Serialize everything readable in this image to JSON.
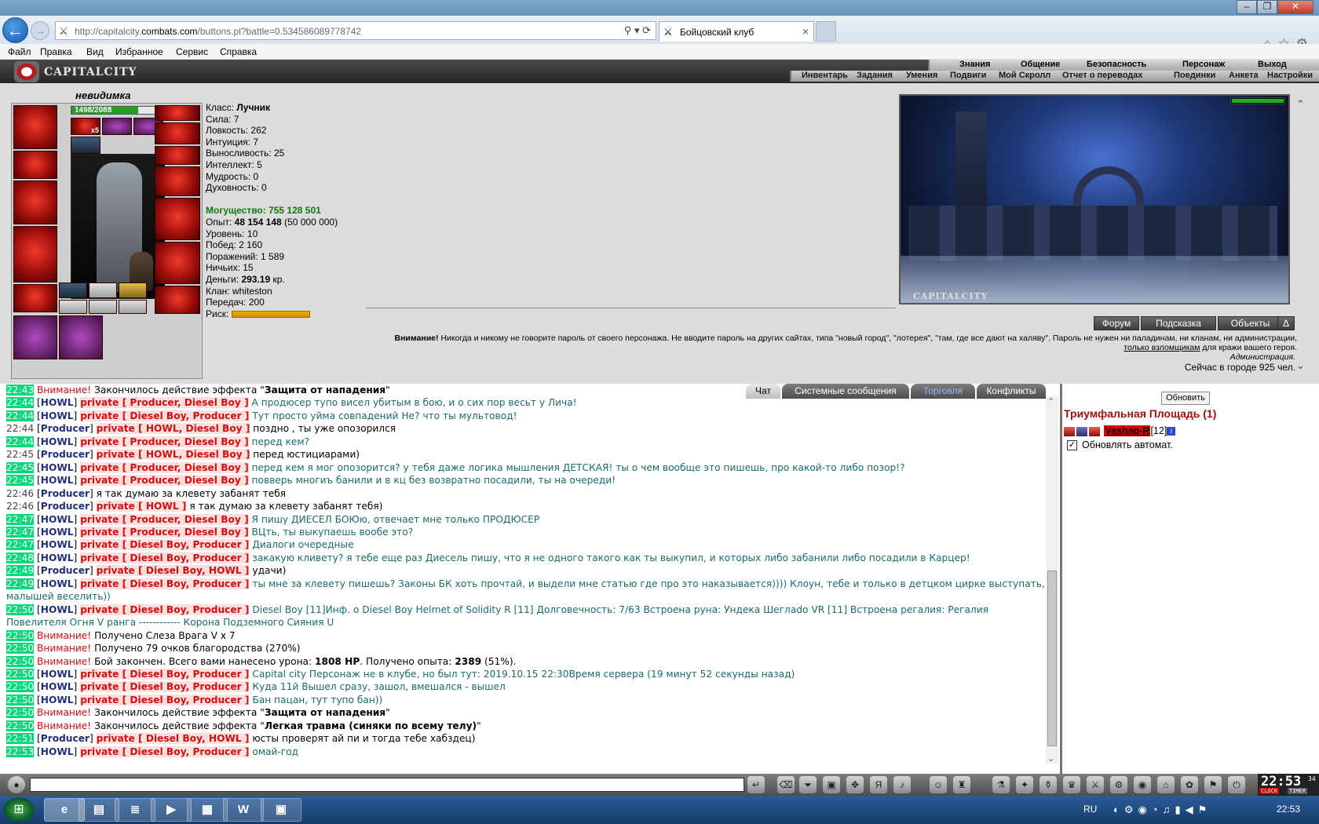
{
  "browser": {
    "url_prefix": "http://capitalcity.",
    "url_host": "combats.com",
    "url_path": "/buttons.pl?battle=0.534586089778742",
    "tab_title": "Бойцовский клуб"
  },
  "menubar": [
    "Файл",
    "Правка",
    "Вид",
    "Избранное",
    "Сервис",
    "Справка"
  ],
  "game": {
    "logo": "CAPITALCITY",
    "nav_top": [
      "Знания",
      "Общение",
      "Безопасность",
      "Персонаж",
      "Выход"
    ],
    "nav_bottom": [
      "Инвентарь",
      "Задания",
      "Умения",
      "Подвиги",
      "Мой Скролл",
      "Отчет о переводах",
      "Поединки",
      "Анкета",
      "Настройки"
    ]
  },
  "character": {
    "name": "невидимка",
    "hp": "1498/2088",
    "hp_fraction": 0.7175,
    "slot_count": "x5",
    "stats": {
      "class_label": "Класс:",
      "class_value": "Лучник",
      "strength": "Сила: 7",
      "agility": "Ловкость: 262",
      "intuition": "Интуиция: 7",
      "endurance": "Выносливость: 25",
      "intellect": "Интеллект: 5",
      "wisdom": "Мудрость: 0",
      "spirit": "Духовность: 0",
      "power": "Могущество: 755 128 501",
      "exp_label": "Опыт:",
      "exp_value": "48 154 148",
      "exp_next": "(50 000 000)",
      "level": "Уровень: 10",
      "wins": "Побед: 2 160",
      "losses": "Поражений: 1 589",
      "draws": "Ничьих: 15",
      "money_label": "Деньги:",
      "money_value": "293.19",
      "money_unit": "кр.",
      "clan": "Клан: whiteston",
      "transfers": "Передач: 200",
      "risk": "Риск:"
    }
  },
  "scene": {
    "caption": "CAPITALCITY",
    "buttons": [
      "Форум",
      "Подсказка",
      "Объекты",
      "Δ"
    ]
  },
  "warning": {
    "label": "Внимание!",
    "text1": "Никогда и никому не говорите пароль от своего персонажа. Не вводите пароль на других сайтах, типа \"новый город\", \"лотерея\", \"там, где все дают на халяву\". Пароль не нужен ни паладинам, ни кланам, ни администрации,",
    "link": "только взломщикам",
    "text2": "для кражи вашего героя.",
    "admin": "Администрация.",
    "online": "Сейчас в городе 925 чел."
  },
  "chat": {
    "tabs": [
      "Чат",
      "Системные сообщения",
      "Торговля",
      "Конфликты"
    ],
    "lines": [
      {
        "t": "22:43",
        "k": "sys",
        "w": "Внимание!",
        "m": "Закончилось действие эффекта \"",
        "b": "Защита от нападения",
        "e": "\""
      },
      {
        "t": "22:44",
        "k": "pm",
        "n": "HOWL",
        "p": "private [ Producer, Diesel Boy ]",
        "m": "А продюсер тупо висел убитым в бою, и о сих пор весьт у Лича!"
      },
      {
        "t": "22:44",
        "k": "pm",
        "n": "HOWL",
        "p": "private [ Diesel Boy, Producer ]",
        "m": "Тут просто уйма совпадений Не? что ты мультовод!"
      },
      {
        "t": "22:44",
        "k": "pm2",
        "n": "Producer",
        "p": "private [ HOWL, Diesel Boy ]",
        "m": "поздно , ты уже опозорился"
      },
      {
        "t": "22:44",
        "k": "pm",
        "n": "HOWL",
        "p": "private [ Producer, Diesel Boy ]",
        "m": "перед кем?"
      },
      {
        "t": "22:45",
        "k": "pm2",
        "n": "Producer",
        "p": "private [ HOWL, Diesel Boy ]",
        "m": "перед юстициарами)"
      },
      {
        "t": "22:45",
        "k": "pm",
        "n": "HOWL",
        "p": "private [ Producer, Diesel Boy ]",
        "m": "перед кем я мог опозорится? у тебя даже логика мышления ДЕТСКАЯ! ты о чем вообще это пишешь, про какой-то либо позор!?"
      },
      {
        "t": "22:45",
        "k": "pm",
        "n": "HOWL",
        "p": "private [ Producer, Diesel Boy ]",
        "m": "повверь многиъ банили и в кц без возвратно посадили, ты на очереди!"
      },
      {
        "t": "22:46",
        "k": "pub",
        "n": "Producer",
        "m": "я так думаю за клевету забанят тебя"
      },
      {
        "t": "22:46",
        "k": "pm2",
        "n": "Producer",
        "p": "private [ HOWL ]",
        "m": "я так думаю за клевету забанят тебя)"
      },
      {
        "t": "22:47",
        "k": "pm",
        "n": "HOWL",
        "p": "private [ Producer, Diesel Boy ]",
        "m": "Я пишу ДИЕСЕЛ БОЮю, отвечает мне только ПРОДЮСЕР"
      },
      {
        "t": "22:47",
        "k": "pm",
        "n": "HOWL",
        "p": "private [ Producer, Diesel Boy ]",
        "m": "ВЦть, ты выкупаешь вообе это?"
      },
      {
        "t": "22:47",
        "k": "pm",
        "n": "HOWL",
        "p": "private [ Diesel Boy, Producer ]",
        "m": "Диалоги очередные"
      },
      {
        "t": "22:48",
        "k": "pm",
        "n": "HOWL",
        "p": "private [ Diesel Boy, Producer ]",
        "m": "закакую кливету? я тебе еще раз Диесель пишу, что я не одного такого как ты выкупил, и которых либо забанили либо посадили в Карцер!"
      },
      {
        "t": "22:49",
        "k": "pm2",
        "n": "Producer",
        "p": "private [ Diesel Boy, HOWL ]",
        "m": "удачи)"
      },
      {
        "t": "22:49",
        "k": "pm",
        "n": "HOWL",
        "p": "private [ Diesel Boy, Producer ]",
        "m": "ты мне за клевету пишешь? Законы БК хоть прочтай, и выдели мне статью где про это наказывается)))) Клоун, тебе и только в детцком цирке выступать, малышей веселить))"
      },
      {
        "t": "22:50",
        "k": "pm",
        "n": "HOWL",
        "p": "private [ Diesel Boy, Producer ]",
        "m": "Diesel Boy [11]Инф. о Diesel Boy Helmet of Solidity R [11] Долговечность: 7/63 Встроена руна: Ундека Шеглadо VR [11] Встроена регалия: Регалия Повелителя Огня V ранга ------------ Корона Подземного Сияния U"
      },
      {
        "t": "22:50",
        "k": "sys",
        "w": "Внимание!",
        "m": "Получено Слеза Врага V x 7"
      },
      {
        "t": "22:50",
        "k": "sys",
        "w": "Внимание!",
        "m": "Получено 79 очков благородства (270%)"
      },
      {
        "t": "22:50",
        "k": "sys",
        "w": "Внимание!",
        "m": "Бой закончен. Всего вами нанесено урона: ",
        "b": "1808 HP",
        "e": ". Получено опыта: ",
        "b2": "2389",
        "e2": " (51%)."
      },
      {
        "t": "22:50",
        "k": "pm",
        "n": "HOWL",
        "p": "private [ Diesel Boy, Producer ]",
        "m": "Capital city Персонаж не в клубе, но был тут: 2019.10.15 22:30Время сервера (19 минут 52 секунды назад)"
      },
      {
        "t": "22:50",
        "k": "pm",
        "n": "HOWL",
        "p": "private [ Diesel Boy, Producer ]",
        "m": "Куда 11й Вышел сразу, зашол, вмешался - вышел"
      },
      {
        "t": "22:50",
        "k": "pm",
        "n": "HOWL",
        "p": "private [ Diesel Boy, Producer ]",
        "m": "Бан пацан, тут тупо бан))"
      },
      {
        "t": "22:50",
        "k": "sys",
        "w": "Внимание!",
        "m": "Закончилось действие эффекта \"",
        "b": "Защита от нападения",
        "e": "\""
      },
      {
        "t": "22:50",
        "k": "sys",
        "w": "Внимание!",
        "m": "Закончилось действие эффекта \"",
        "b": "Легкая травма (синяки по всему телу)",
        "e": "\""
      },
      {
        "t": "22:51",
        "k": "pm2",
        "n": "Producer",
        "p": "private [ Diesel Boy, HOWL ]",
        "m": "юсты проверят ай пи и тогда тебе хабздец)"
      },
      {
        "t": "22:53",
        "k": "pm",
        "n": "HOWL",
        "p": "private [ Diesel Boy, Producer ]",
        "m": "омай-год"
      }
    ]
  },
  "side": {
    "refresh": "Обновить",
    "location": "Триумфальная Площадь (1)",
    "user_nick": "Vashaq-R",
    "user_level": "[12]",
    "info": "i",
    "auto_label": "Обновлять автомат.",
    "auto_checked": "✓"
  },
  "clock": {
    "time": "22:53",
    "sec": "34",
    "l1": "CLOCK",
    "l2": "TIMER"
  },
  "taskbar": {
    "lang": "RU",
    "time": "22:53"
  }
}
